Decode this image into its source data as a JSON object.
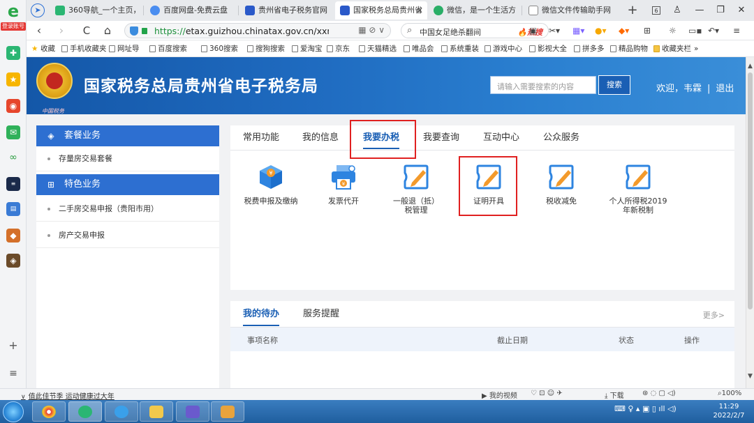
{
  "browser": {
    "sidebar": {
      "logo": "e",
      "login_badge": "登录账号"
    },
    "tabs": [
      {
        "label": "360导航_一个主页，",
        "active": false
      },
      {
        "label": "百度网盘-免费云盘",
        "active": false
      },
      {
        "label": "贵州省电子税务官网",
        "active": false
      },
      {
        "label": "国家税务总局贵州省",
        "active": true
      },
      {
        "label": "微信，是一个生活方",
        "active": false
      },
      {
        "label": "微信文件传输助手网",
        "active": false
      }
    ],
    "new_tab": "+",
    "tab_count": "6",
    "window_buttons": {
      "minimize": "—",
      "restore": "❐",
      "close": "✕"
    },
    "nav": {
      "back": "‹",
      "forward": "›",
      "refresh": "C",
      "home": "⌂"
    },
    "url": {
      "scheme": "https://",
      "host": "etax.guizhou.chinatax.gov.cn",
      "path": "/xxmh/html/inc"
    },
    "search": {
      "text": "中国女足绝杀翻间",
      "hot_label": "热搜"
    },
    "bookmarks": [
      "收藏",
      "手机收藏夹",
      "网址导",
      "百度搜索",
      "360搜索",
      "搜狗搜索",
      "爱淘宝",
      "京东",
      "天猫精选",
      "唯品会",
      "系统重装",
      "游戏中心",
      "影视大全",
      "拼多多",
      "精品购物",
      "收藏夹栏",
      "»"
    ]
  },
  "site": {
    "emblem_caption": "中国税务",
    "title": "国家税务总局贵州省电子税务局",
    "search_placeholder": "请输入需要搜索的内容",
    "search_button": "搜索",
    "welcome": "欢迎，韦霖",
    "logout": "退出"
  },
  "left_panel": {
    "sections": [
      {
        "title": "套餐业务",
        "items": [
          "存量房交易套餐"
        ]
      },
      {
        "title": "特色业务",
        "items": [
          "二手房交易申报（贵阳市用）",
          "房产交易申报"
        ]
      }
    ]
  },
  "main_tabs": [
    {
      "label": "常用功能",
      "active": false
    },
    {
      "label": "我的信息",
      "active": false
    },
    {
      "label": "我要办税",
      "active": true
    },
    {
      "label": "我要查询",
      "active": false
    },
    {
      "label": "互动中心",
      "active": false
    },
    {
      "label": "公众服务",
      "active": false
    }
  ],
  "functions": [
    {
      "label": "税费申报及缴纳",
      "icon": "cube-icon"
    },
    {
      "label": "发票代开",
      "icon": "printer-icon"
    },
    {
      "label": "一般退（抵）税管理",
      "icon": "edit-icon"
    },
    {
      "label": "证明开具",
      "icon": "edit-icon"
    },
    {
      "label": "税收减免",
      "icon": "edit-icon"
    },
    {
      "label": "个人所得税2019年新税制",
      "icon": "edit-icon"
    }
  ],
  "todo": {
    "tabs": [
      {
        "label": "我的待办",
        "active": true
      },
      {
        "label": "服务提醒",
        "active": false
      }
    ],
    "more": "更多>",
    "columns": [
      "事项名称",
      "截止日期",
      "状态",
      "操作"
    ]
  },
  "statusbar": {
    "news_prefix": "∨",
    "news": "值此佳节季 运动健康过大年",
    "items": [
      "我的视频",
      "下载",
      "100%"
    ]
  },
  "taskbar": {
    "time": "11:29",
    "date": "2022/2/7"
  },
  "colors": {
    "brand_blue": "#1a5fb4",
    "highlight_red": "#e02020",
    "icon_blue": "#2e84e0",
    "icon_orange": "#f39a2b"
  }
}
